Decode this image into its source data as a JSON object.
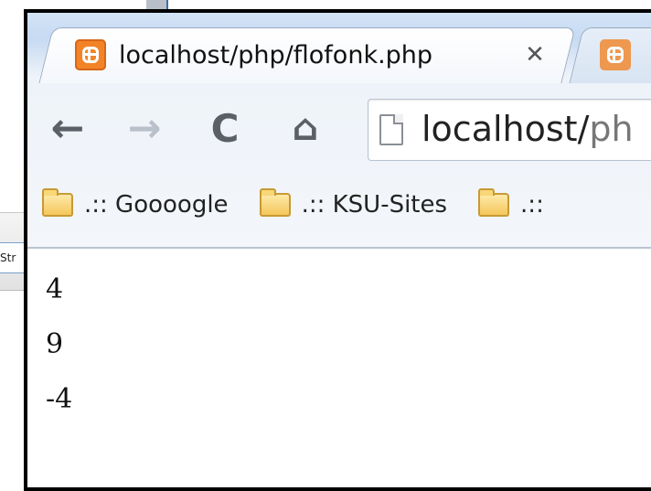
{
  "background": {
    "partial_label": "Str"
  },
  "browser": {
    "tab": {
      "title": "localhost/php/flofonk.php",
      "close_glyph": "✕",
      "icon": "xampp-icon"
    },
    "second_tab": {
      "icon": "xampp-icon"
    },
    "toolbar": {
      "back_glyph": "←",
      "forward_glyph": "→",
      "reload_glyph": "C",
      "home_glyph": "⌂",
      "url_host": "localhost/",
      "url_rest": "ph"
    },
    "bookmarks": [
      {
        "label": ".:: Goooogle",
        "icon": "folder-icon"
      },
      {
        "label": ".:: KSU-Sites",
        "icon": "folder-icon"
      },
      {
        "label": ".::",
        "icon": "folder-icon"
      }
    ]
  },
  "page": {
    "lines": [
      "4",
      "9",
      "-4"
    ]
  },
  "colors": {
    "xampp_orange": "#f28427",
    "chrome_blue": "#c6daf2",
    "window_border": "#000000"
  }
}
